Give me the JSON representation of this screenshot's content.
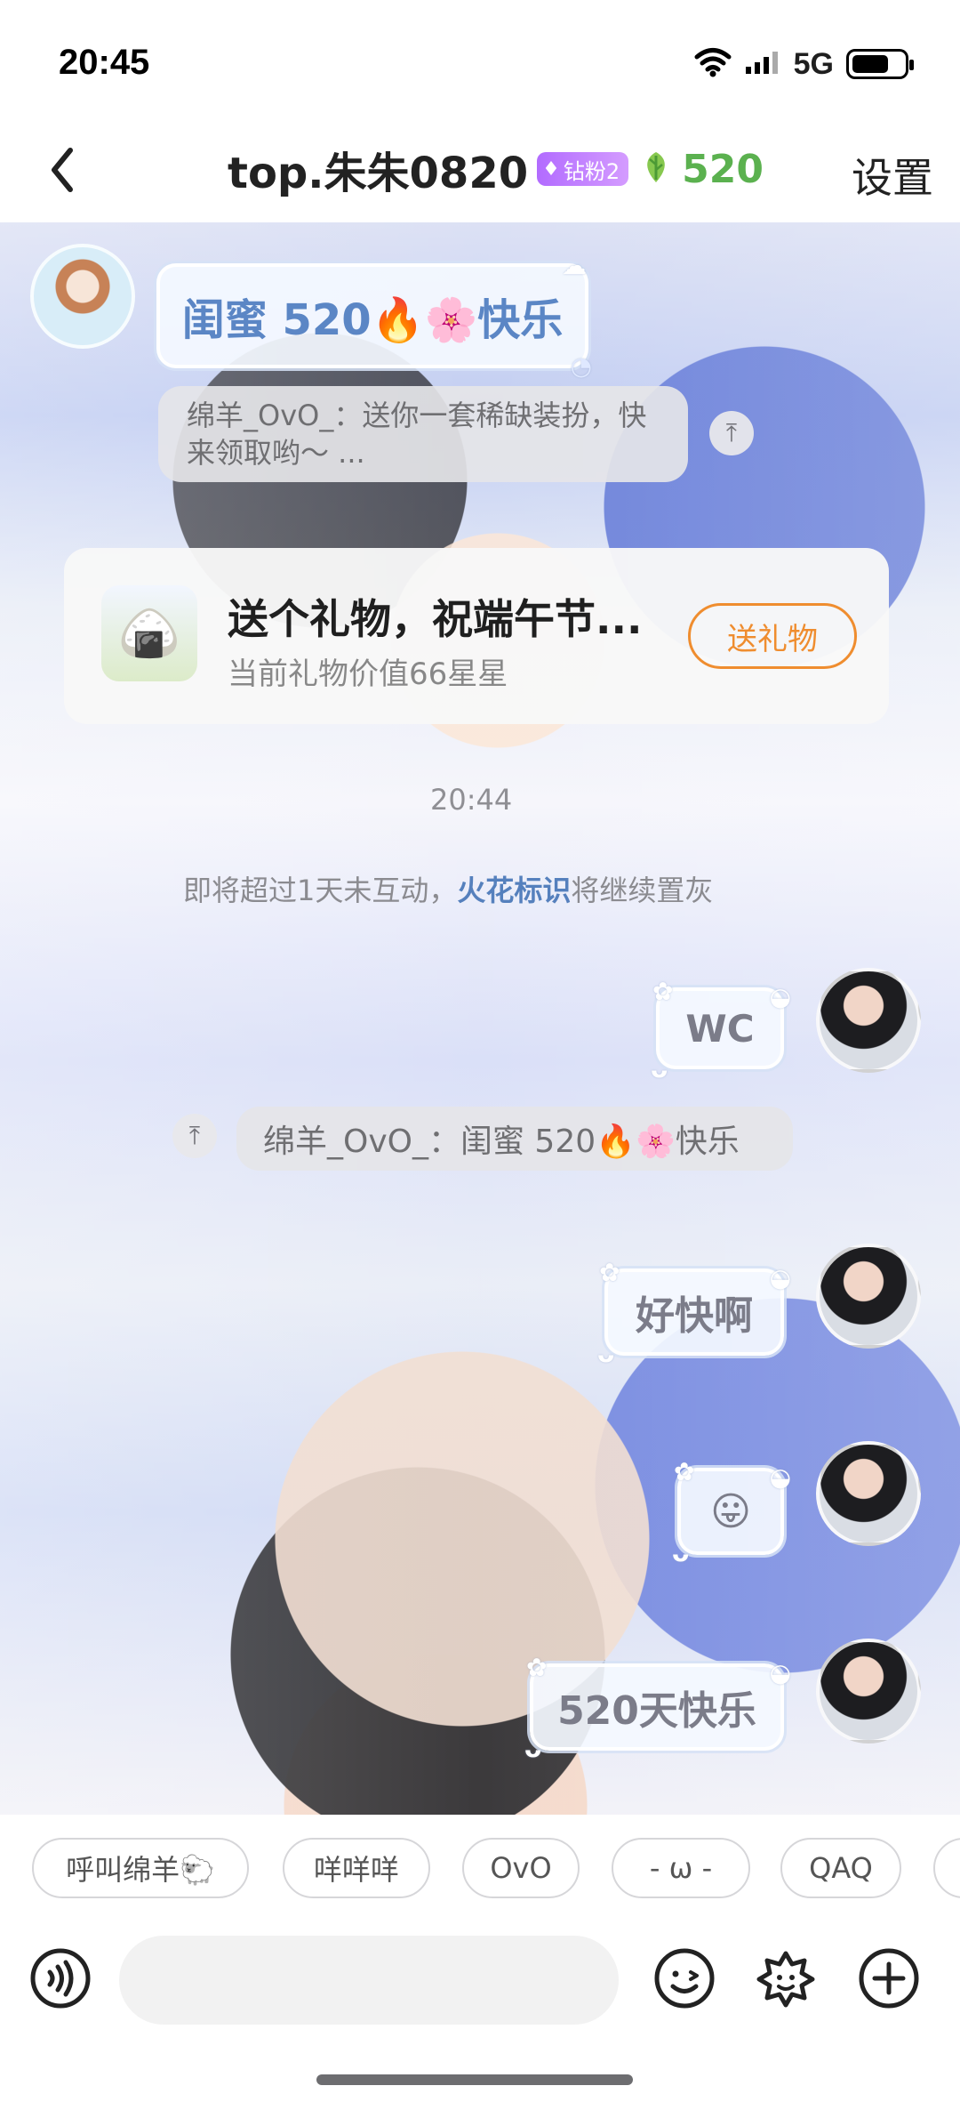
{
  "status_bar": {
    "time": "20:45",
    "network": "5G",
    "battery_level": 0.72,
    "icons": [
      "wifi-icon",
      "signal-icon",
      "battery-icon"
    ]
  },
  "header": {
    "back_icon": "chevron-left-icon",
    "title": "top.朱朱0820",
    "badge": {
      "icon": "diamond-icon",
      "text": "钻粉2"
    },
    "leaf_icon": "leaf-icon",
    "leaf_count": "520",
    "settings_label": "设置"
  },
  "messages": {
    "top_message": "闺蜜 520🔥🌸快乐",
    "system_reply_1": "绵羊_OvO_：送你一套稀缺装扮，快来领取哟～ ...",
    "gift_card": {
      "title": "送个礼物，祝端午节...",
      "subtitle": "当前礼物价值66星星",
      "button": "送礼物",
      "icon": "zongzi-icon"
    },
    "timestamp": "20:44",
    "notice_prefix": "即将超过1天未互动，",
    "notice_link": "火花标识",
    "notice_suffix": "将继续置灰",
    "wc": "WC",
    "quoted_reply": "绵羊_OvO_：闺蜜 520🔥🌸快乐",
    "fast": "好快啊",
    "emoji": "😛",
    "last": "520天快乐"
  },
  "quick_replies": [
    "呼叫绵羊🐑",
    "咩咩咩",
    "OvO",
    "- ω -",
    "QAQ"
  ],
  "composer": {
    "input_value": "",
    "input_placeholder": "",
    "voice_icon": "voice-icon",
    "emoji_icon": "smile-icon",
    "sticker_icon": "flower-icon",
    "plus_icon": "plus-icon"
  }
}
